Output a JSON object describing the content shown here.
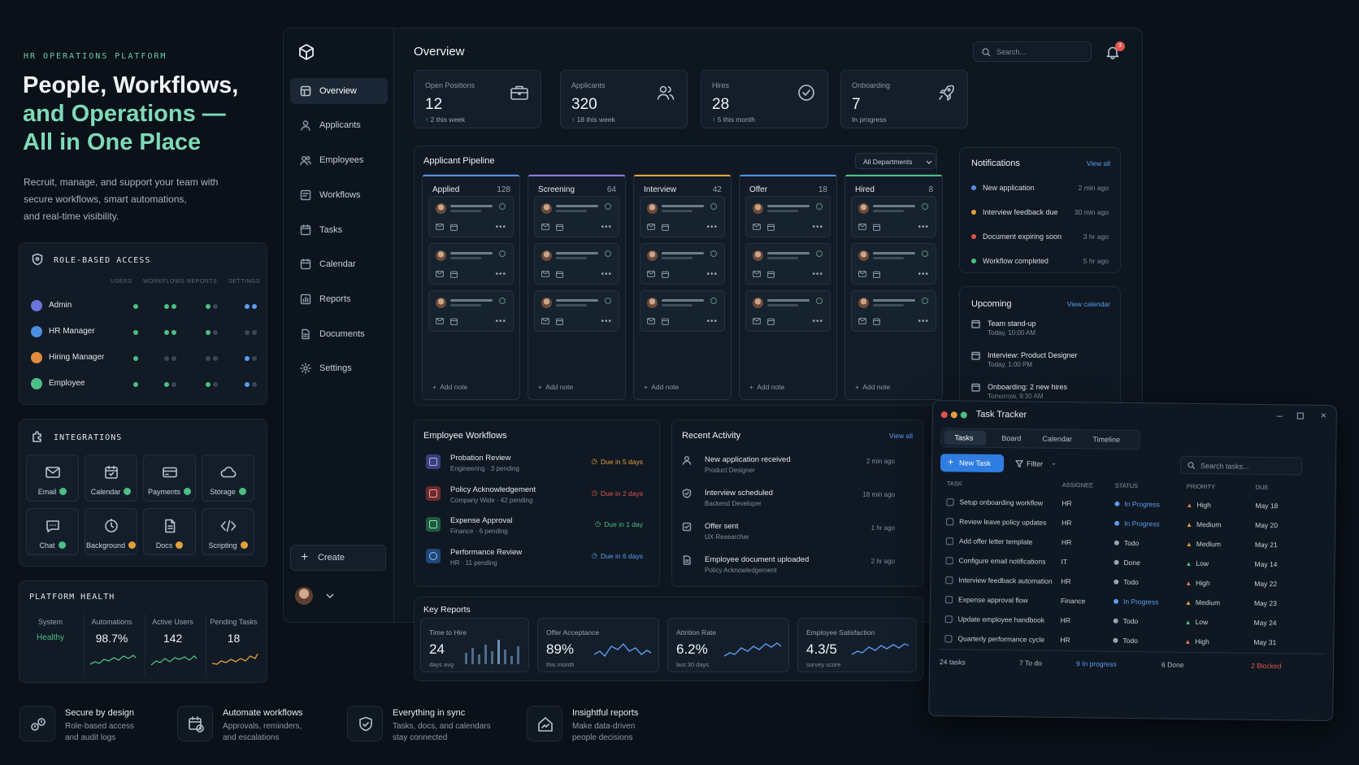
{
  "hero": {
    "eyebrow": "HR OPERATIONS PLATFORM",
    "line1": "People, Workflows,",
    "line2": "and Operations —",
    "line3": "All in One Place",
    "desc1": "Recruit, manage, and support your team with",
    "desc2": "secure workflows, smart automations,",
    "desc3": "and real-time visibility."
  },
  "access": {
    "title": "ROLE-BASED ACCESS",
    "columns": [
      "USERS",
      "WORKFLOWS",
      "REPORTS",
      "SETTINGS"
    ],
    "roles": [
      {
        "name": "Admin",
        "color": "#6b74d8"
      },
      {
        "name": "HR Manager",
        "color": "#4a8fe0"
      },
      {
        "name": "Hiring Manager",
        "color": "#e08a3a"
      },
      {
        "name": "Employee",
        "color": "#4cbf85"
      }
    ]
  },
  "integrations": {
    "title": "INTEGRATIONS",
    "items": [
      {
        "label": "Email",
        "icon": "mail-icon",
        "status": "connected"
      },
      {
        "label": "Calendar",
        "icon": "calendar-icon",
        "status": "connected"
      },
      {
        "label": "Payments",
        "icon": "card-icon",
        "status": "connected"
      },
      {
        "label": "Storage",
        "icon": "cloud-icon",
        "status": "connected"
      },
      {
        "label": "Chat",
        "icon": "chat-icon",
        "status": "connected"
      },
      {
        "label": "Background",
        "icon": "shield-clock-icon",
        "status": "pending"
      },
      {
        "label": "Docs",
        "icon": "document-icon",
        "status": "pending"
      },
      {
        "label": "Scripting",
        "icon": "code-icon",
        "status": "pending"
      }
    ]
  },
  "health": {
    "title": "PLATFORM HEALTH",
    "system_label": "System",
    "system_value": "Healthy",
    "automations_label": "Automations",
    "automations_value": "98.7%",
    "users_label": "Active Users",
    "users_value": "142",
    "pending_label": "Pending Tasks",
    "pending_value": "18"
  },
  "features": [
    {
      "title": "Secure by design",
      "line1": "Role-based access",
      "line2": "and audit logs"
    },
    {
      "title": "Automate workflows",
      "line1": "Approvals, reminders,",
      "line2": "and escalations"
    },
    {
      "title": "Everything in sync",
      "line1": "Tasks, docs, and calendars",
      "line2": "stay connected"
    },
    {
      "title": "Insightful reports",
      "line1": "Make data-driven",
      "line2": "people decisions"
    }
  ],
  "nav": {
    "items": [
      "Overview",
      "Applicants",
      "Employees",
      "Workflows",
      "Tasks",
      "Calendar",
      "Reports",
      "Documents",
      "Settings"
    ],
    "create": "Create"
  },
  "header": {
    "title": "Overview",
    "search_placeholder": "Search...",
    "notification_count": "3"
  },
  "kpis": [
    {
      "label": "Open Positions",
      "value": "12",
      "sub": "2 this week",
      "trend": "up"
    },
    {
      "label": "Applicants",
      "value": "320",
      "sub": "18 this week",
      "trend": "up"
    },
    {
      "label": "Hires",
      "value": "28",
      "sub": "5 this month",
      "trend": "up"
    },
    {
      "label": "Onboarding",
      "value": "7",
      "sub": "In progress",
      "trend": "none"
    }
  ],
  "pipeline": {
    "title": "Applicant Pipeline",
    "filter": "All Departments",
    "add_label": "Add note",
    "columns": [
      {
        "name": "Applied",
        "count": "128",
        "color": "#5b8de8"
      },
      {
        "name": "Screening",
        "count": "64",
        "color": "#8f7bd8"
      },
      {
        "name": "Interview",
        "count": "42",
        "color": "#e2a13b"
      },
      {
        "name": "Offer",
        "count": "18",
        "color": "#4d8fe4"
      },
      {
        "name": "Hired",
        "count": "8",
        "color": "#4cbf85"
      }
    ]
  },
  "notifications": {
    "title": "Notifications",
    "view_all": "View all",
    "items": [
      {
        "text": "New application",
        "time": "2 min ago",
        "color": "#5b8de8"
      },
      {
        "text": "Interview feedback due",
        "time": "30 min ago",
        "color": "#e2a13b"
      },
      {
        "text": "Document expiring soon",
        "time": "3 hr ago",
        "color": "#e0544f"
      },
      {
        "text": "Workflow completed",
        "time": "5 hr ago",
        "color": "#4cbf85"
      }
    ]
  },
  "upcoming": {
    "title": "Upcoming",
    "view": "View calendar",
    "items": [
      {
        "title": "Team stand-up",
        "time": "Today, 10:00 AM"
      },
      {
        "title": "Interview: Product Designer",
        "time": "Today, 1:00 PM"
      },
      {
        "title": "Onboarding: 2 new hires",
        "time": "Tomorrow, 9:30 AM"
      }
    ]
  },
  "workflows": {
    "title": "Employee Workflows",
    "items": [
      {
        "name": "Probation Review",
        "sub": "Engineering · 3 pending",
        "due": "Due in 5 days",
        "color": "#6b74d8",
        "due_color": "#e2a13b"
      },
      {
        "name": "Policy Acknowledgement",
        "sub": "Company Wide · 42 pending",
        "due": "Due in 2 days",
        "color": "#e0544f",
        "due_color": "#e0544f"
      },
      {
        "name": "Expense Approval",
        "sub": "Finance · 6 pending",
        "due": "Due in 1 day",
        "color": "#3fae78",
        "due_color": "#4cbf85"
      },
      {
        "name": "Performance Review",
        "sub": "HR · 11 pending",
        "due": "Due in 6 days",
        "color": "#4d8fe4",
        "due_color": "#5b9cf0"
      }
    ]
  },
  "activity": {
    "title": "Recent Activity",
    "view_all": "View all",
    "items": [
      {
        "title": "New application received",
        "sub": "Product Designer",
        "time": "2 min ago"
      },
      {
        "title": "Interview scheduled",
        "sub": "Backend Developer",
        "time": "18 min ago"
      },
      {
        "title": "Offer sent",
        "sub": "UX Researcher",
        "time": "1 hr ago"
      },
      {
        "title": "Employee document uploaded",
        "sub": "Policy Acknowledgement",
        "time": "2 hr ago"
      }
    ]
  },
  "reports": {
    "title": "Key Reports",
    "items": [
      {
        "label": "Time to Hire",
        "value": "24",
        "sub": "days avg"
      },
      {
        "label": "Offer Acceptance",
        "value": "89%",
        "sub": "this month"
      },
      {
        "label": "Attrition Rate",
        "value": "6.2%",
        "sub": "last 30 days"
      },
      {
        "label": "Employee Satisfaction",
        "value": "4.3/5",
        "sub": "survey score"
      }
    ]
  },
  "tracker": {
    "title": "Task Tracker",
    "tabs": [
      "Tasks",
      "Board",
      "Calendar",
      "Timeline"
    ],
    "new_task": "New Task",
    "filter": "Filter",
    "search_placeholder": "Search tasks...",
    "headers": [
      "TASK",
      "ASSIGNEE",
      "STATUS",
      "PRIORITY",
      "DUE"
    ],
    "rows": [
      {
        "task": "Setup onboarding workflow",
        "assignee": "HR",
        "status": "In Progress",
        "priority": "High",
        "due": "May 18"
      },
      {
        "task": "Review leave policy updates",
        "assignee": "HR",
        "status": "In Progress",
        "priority": "Medium",
        "due": "May 20"
      },
      {
        "task": "Add offer letter template",
        "assignee": "HR",
        "status": "Todo",
        "priority": "Medium",
        "due": "May 21"
      },
      {
        "task": "Configure email notifications",
        "assignee": "IT",
        "status": "Done",
        "priority": "Low",
        "due": "May 14"
      },
      {
        "task": "Interview feedback automation",
        "assignee": "HR",
        "status": "Todo",
        "priority": "High",
        "due": "May 22"
      },
      {
        "task": "Expense approval flow",
        "assignee": "Finance",
        "status": "In Progress",
        "priority": "Medium",
        "due": "May 23"
      },
      {
        "task": "Update employee handbook",
        "assignee": "HR",
        "status": "Todo",
        "priority": "Low",
        "due": "May 24"
      },
      {
        "task": "Quarterly performance cycle",
        "assignee": "HR",
        "status": "Todo",
        "priority": "High",
        "due": "May 31"
      }
    ],
    "footer": {
      "total": "24 tasks",
      "todo": "7 To do",
      "in_progress": "9 In progress",
      "done": "6 Done",
      "blocked": "2 Blocked"
    }
  },
  "colors": {
    "accent": "#7fd9b6",
    "brand_blue": "#2f7de1",
    "in_progress": "#5b9cf0",
    "todo": "#9aa5b3",
    "done": "#9aa5b3",
    "high": "#e07a4f",
    "medium": "#e2a13b",
    "low": "#4cbf85"
  }
}
